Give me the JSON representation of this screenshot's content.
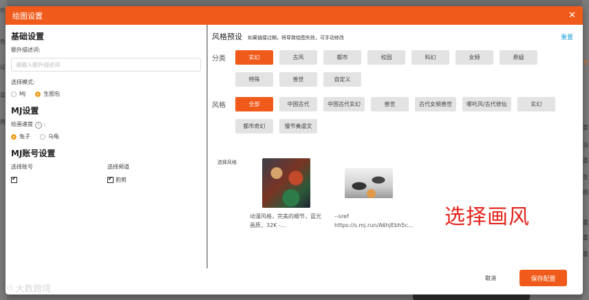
{
  "backdrop": {
    "left_text": [
      "作",
      "色",
      "设",
      "菜",
      "用"
    ],
    "right_text": [
      "重",
      "当",
      "重",
      "图",
      "生",
      "图",
      "重",
      "重",
      "重"
    ],
    "right_orange": "仓"
  },
  "dialog": {
    "title": "绘图设置",
    "close_icon": "close-icon"
  },
  "basic": {
    "title": "基础设置",
    "extra_desc_label": "额外描述词:",
    "extra_desc_placeholder": "请输入额外描述词",
    "mode_label": "选择模式:",
    "modes": [
      {
        "label": "MJ",
        "selected": false
      },
      {
        "label": "生图包",
        "selected": true
      }
    ]
  },
  "mj": {
    "title": "MJ设置",
    "speed_label": "绘画速度",
    "speeds": [
      {
        "label": "兔子",
        "selected": true
      },
      {
        "label": "乌龟",
        "selected": false
      }
    ]
  },
  "mj_account": {
    "title": "MJ账号设置",
    "account_header": "选择账号",
    "channel_header": "选择频道",
    "channel_value": "豹剪"
  },
  "style_preset": {
    "title": "风格预设",
    "note": "如果链接过期，将导致绘图失败，可手动修改",
    "reset_label": "重置",
    "category_label": "分类",
    "categories": [
      {
        "label": "玄幻",
        "active": true
      },
      {
        "label": "古风",
        "active": false
      },
      {
        "label": "都市",
        "active": false
      },
      {
        "label": "校园",
        "active": false
      },
      {
        "label": "科幻",
        "active": false
      },
      {
        "label": "女频",
        "active": false
      },
      {
        "label": "悬疑",
        "active": false
      },
      {
        "label": "特殊",
        "active": false
      },
      {
        "label": "兽世",
        "active": false
      },
      {
        "label": "自定义",
        "active": false
      }
    ],
    "style_label": "风格",
    "styles": [
      {
        "label": "全部",
        "active": true
      },
      {
        "label": "中国古代",
        "active": false
      },
      {
        "label": "中国古代玄幻",
        "active": false
      },
      {
        "label": "兽世",
        "active": false
      },
      {
        "label": "古代女频兽世",
        "active": false
      },
      {
        "label": "哪吒风/古代修仙",
        "active": false
      },
      {
        "label": "玄幻",
        "active": false
      },
      {
        "label": "都市奇幻",
        "active": false
      },
      {
        "label": "慢节奏虐文",
        "active": false
      }
    ],
    "select_style_label": "选择风格",
    "cards": [
      {
        "caption": "动漫风格，完美的细节，蓝光画质，32K -..."
      },
      {
        "caption": "--sref https://s.mj.run/A6hJEbh5c..."
      }
    ],
    "overlay_text": "选择画风"
  },
  "footer": {
    "cancel_label": "取消",
    "save_label": "保存配置"
  },
  "watermark": {
    "text": "大数跨境"
  }
}
